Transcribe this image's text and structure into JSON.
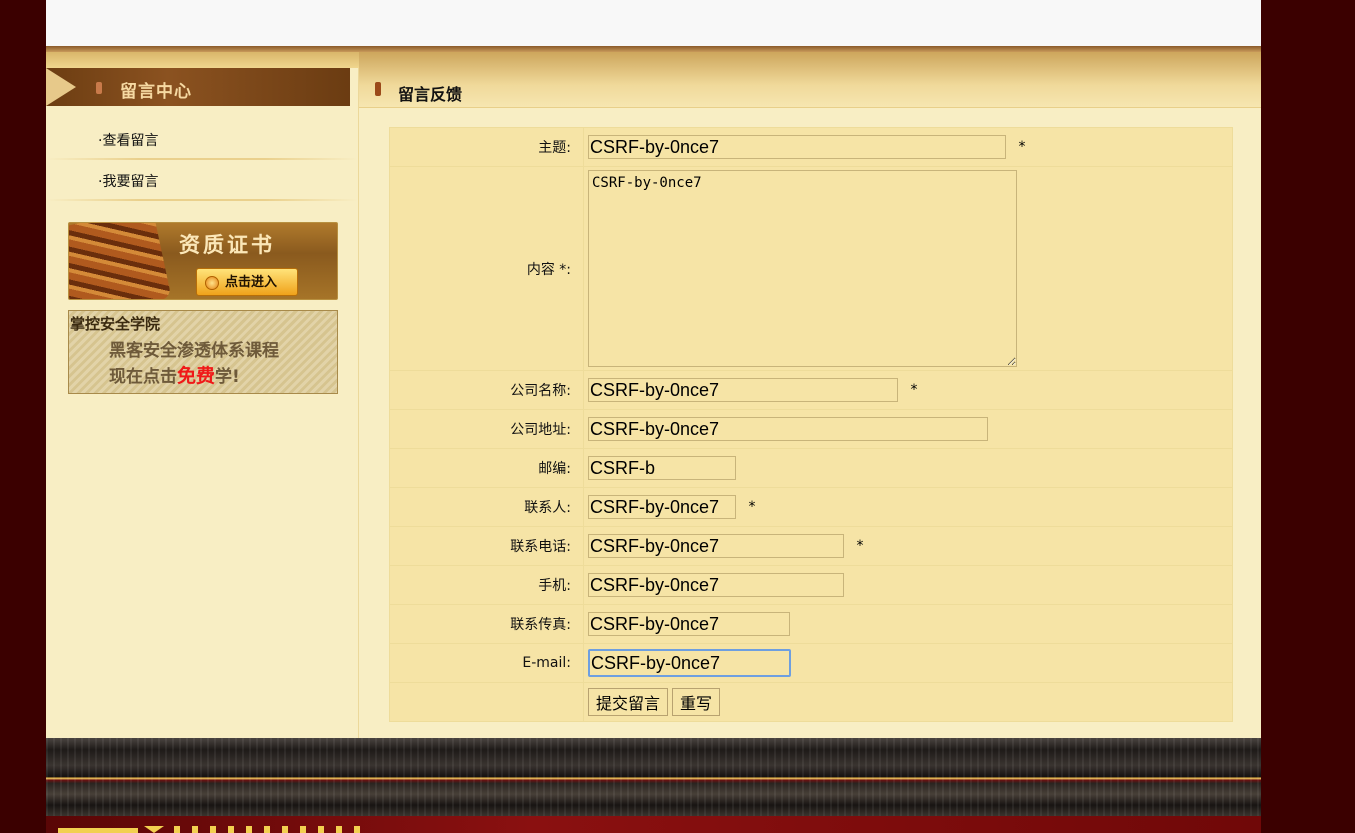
{
  "sidebar": {
    "title": "留言中心",
    "links": [
      {
        "label": "·查看留言"
      },
      {
        "label": "·我要留言"
      }
    ],
    "cert_banner": {
      "title": "资质证书",
      "button": "点击进入"
    },
    "academy_banner": {
      "title": "掌控安全学院",
      "line1": "黑客安全渗透体系课程",
      "line2_prefix": "现在点击",
      "line2_highlight": "免费",
      "line2_suffix": "学!"
    }
  },
  "content": {
    "title": "留言反馈",
    "form": {
      "subject": {
        "label": "主题:",
        "value": "CSRF-by-0nce7",
        "required": "*"
      },
      "content": {
        "label": "内容 *:",
        "value": "CSRF-by-0nce7"
      },
      "company": {
        "label": "公司名称:",
        "value": "CSRF-by-0nce7",
        "required": "*"
      },
      "address": {
        "label": "公司地址:",
        "value": "CSRF-by-0nce7"
      },
      "zip": {
        "label": "邮编:",
        "value": "CSRF-b"
      },
      "contact": {
        "label": "联系人:",
        "value": "CSRF-by-0nce7",
        "required": "*"
      },
      "phone": {
        "label": "联系电话:",
        "value": "CSRF-by-0nce7",
        "required": "*"
      },
      "mobile": {
        "label": "手机:",
        "value": "CSRF-by-0nce7"
      },
      "fax": {
        "label": "联系传真:",
        "value": "CSRF-by-0nce7"
      },
      "email": {
        "label": "E-mail:",
        "value": "CSRF-by-0nce7"
      },
      "submit_label": "提交留言",
      "reset_label": "重写"
    }
  },
  "colors": {
    "page_bg": "#3b0000",
    "panel_bg": "#f8eec4",
    "form_bg": "#f6e4a6",
    "focus_border": "#6e9fe0"
  }
}
